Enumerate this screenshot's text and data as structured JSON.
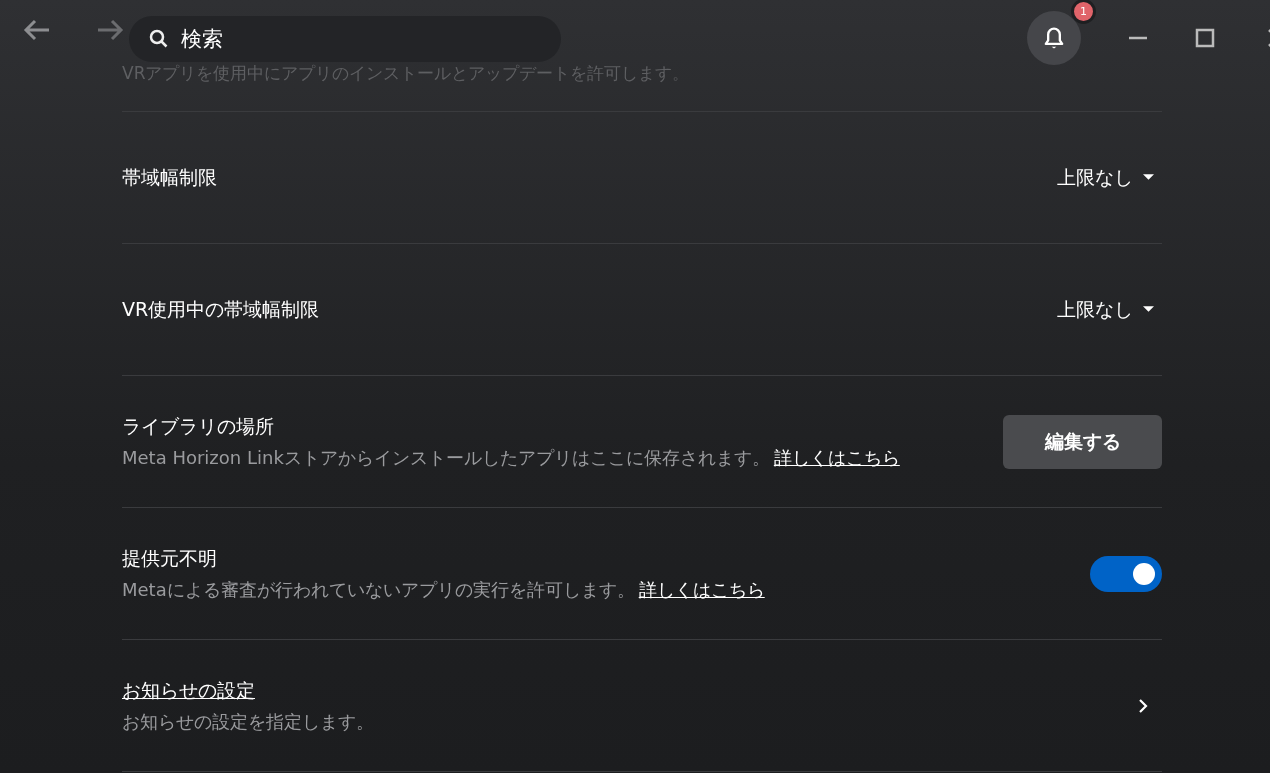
{
  "header": {
    "search": {
      "value": "検索"
    },
    "notifications": {
      "badge": "1"
    }
  },
  "top_hint": "VRアプリを使用中にアプリのインストールとアップデートを許可します。",
  "settings": [
    {
      "kind": "dropdown",
      "title": "帯域幅制限",
      "value": "上限なし"
    },
    {
      "kind": "dropdown",
      "title": "VR使用中の帯域幅制限",
      "value": "上限なし"
    },
    {
      "kind": "button",
      "title": "ライブラリの場所",
      "description": "Meta Horizon Linkストアからインストールしたアプリはここに保存されます。",
      "link": "詳しくはこちら",
      "button": "編集する"
    },
    {
      "kind": "toggle",
      "title": "提供元不明",
      "description": "Metaによる審査が行われていないアプリの実行を許可します。",
      "link": "詳しくはこちら",
      "on": true
    },
    {
      "kind": "nav",
      "title": "お知らせの設定",
      "description": "お知らせの設定を指定します。"
    }
  ]
}
